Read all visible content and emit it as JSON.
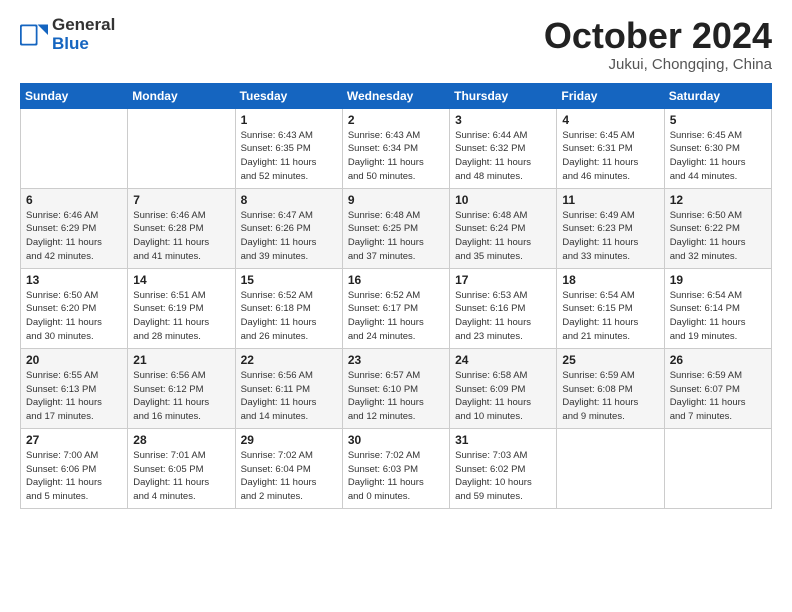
{
  "logo": {
    "general": "General",
    "blue": "Blue"
  },
  "header": {
    "month": "October 2024",
    "location": "Jukui, Chongqing, China"
  },
  "weekdays": [
    "Sunday",
    "Monday",
    "Tuesday",
    "Wednesday",
    "Thursday",
    "Friday",
    "Saturday"
  ],
  "weeks": [
    [
      {
        "day": "",
        "info": ""
      },
      {
        "day": "",
        "info": ""
      },
      {
        "day": "1",
        "info": "Sunrise: 6:43 AM\nSunset: 6:35 PM\nDaylight: 11 hours\nand 52 minutes."
      },
      {
        "day": "2",
        "info": "Sunrise: 6:43 AM\nSunset: 6:34 PM\nDaylight: 11 hours\nand 50 minutes."
      },
      {
        "day": "3",
        "info": "Sunrise: 6:44 AM\nSunset: 6:32 PM\nDaylight: 11 hours\nand 48 minutes."
      },
      {
        "day": "4",
        "info": "Sunrise: 6:45 AM\nSunset: 6:31 PM\nDaylight: 11 hours\nand 46 minutes."
      },
      {
        "day": "5",
        "info": "Sunrise: 6:45 AM\nSunset: 6:30 PM\nDaylight: 11 hours\nand 44 minutes."
      }
    ],
    [
      {
        "day": "6",
        "info": "Sunrise: 6:46 AM\nSunset: 6:29 PM\nDaylight: 11 hours\nand 42 minutes."
      },
      {
        "day": "7",
        "info": "Sunrise: 6:46 AM\nSunset: 6:28 PM\nDaylight: 11 hours\nand 41 minutes."
      },
      {
        "day": "8",
        "info": "Sunrise: 6:47 AM\nSunset: 6:26 PM\nDaylight: 11 hours\nand 39 minutes."
      },
      {
        "day": "9",
        "info": "Sunrise: 6:48 AM\nSunset: 6:25 PM\nDaylight: 11 hours\nand 37 minutes."
      },
      {
        "day": "10",
        "info": "Sunrise: 6:48 AM\nSunset: 6:24 PM\nDaylight: 11 hours\nand 35 minutes."
      },
      {
        "day": "11",
        "info": "Sunrise: 6:49 AM\nSunset: 6:23 PM\nDaylight: 11 hours\nand 33 minutes."
      },
      {
        "day": "12",
        "info": "Sunrise: 6:50 AM\nSunset: 6:22 PM\nDaylight: 11 hours\nand 32 minutes."
      }
    ],
    [
      {
        "day": "13",
        "info": "Sunrise: 6:50 AM\nSunset: 6:20 PM\nDaylight: 11 hours\nand 30 minutes."
      },
      {
        "day": "14",
        "info": "Sunrise: 6:51 AM\nSunset: 6:19 PM\nDaylight: 11 hours\nand 28 minutes."
      },
      {
        "day": "15",
        "info": "Sunrise: 6:52 AM\nSunset: 6:18 PM\nDaylight: 11 hours\nand 26 minutes."
      },
      {
        "day": "16",
        "info": "Sunrise: 6:52 AM\nSunset: 6:17 PM\nDaylight: 11 hours\nand 24 minutes."
      },
      {
        "day": "17",
        "info": "Sunrise: 6:53 AM\nSunset: 6:16 PM\nDaylight: 11 hours\nand 23 minutes."
      },
      {
        "day": "18",
        "info": "Sunrise: 6:54 AM\nSunset: 6:15 PM\nDaylight: 11 hours\nand 21 minutes."
      },
      {
        "day": "19",
        "info": "Sunrise: 6:54 AM\nSunset: 6:14 PM\nDaylight: 11 hours\nand 19 minutes."
      }
    ],
    [
      {
        "day": "20",
        "info": "Sunrise: 6:55 AM\nSunset: 6:13 PM\nDaylight: 11 hours\nand 17 minutes."
      },
      {
        "day": "21",
        "info": "Sunrise: 6:56 AM\nSunset: 6:12 PM\nDaylight: 11 hours\nand 16 minutes."
      },
      {
        "day": "22",
        "info": "Sunrise: 6:56 AM\nSunset: 6:11 PM\nDaylight: 11 hours\nand 14 minutes."
      },
      {
        "day": "23",
        "info": "Sunrise: 6:57 AM\nSunset: 6:10 PM\nDaylight: 11 hours\nand 12 minutes."
      },
      {
        "day": "24",
        "info": "Sunrise: 6:58 AM\nSunset: 6:09 PM\nDaylight: 11 hours\nand 10 minutes."
      },
      {
        "day": "25",
        "info": "Sunrise: 6:59 AM\nSunset: 6:08 PM\nDaylight: 11 hours\nand 9 minutes."
      },
      {
        "day": "26",
        "info": "Sunrise: 6:59 AM\nSunset: 6:07 PM\nDaylight: 11 hours\nand 7 minutes."
      }
    ],
    [
      {
        "day": "27",
        "info": "Sunrise: 7:00 AM\nSunset: 6:06 PM\nDaylight: 11 hours\nand 5 minutes."
      },
      {
        "day": "28",
        "info": "Sunrise: 7:01 AM\nSunset: 6:05 PM\nDaylight: 11 hours\nand 4 minutes."
      },
      {
        "day": "29",
        "info": "Sunrise: 7:02 AM\nSunset: 6:04 PM\nDaylight: 11 hours\nand 2 minutes."
      },
      {
        "day": "30",
        "info": "Sunrise: 7:02 AM\nSunset: 6:03 PM\nDaylight: 11 hours\nand 0 minutes."
      },
      {
        "day": "31",
        "info": "Sunrise: 7:03 AM\nSunset: 6:02 PM\nDaylight: 10 hours\nand 59 minutes."
      },
      {
        "day": "",
        "info": ""
      },
      {
        "day": "",
        "info": ""
      }
    ]
  ]
}
